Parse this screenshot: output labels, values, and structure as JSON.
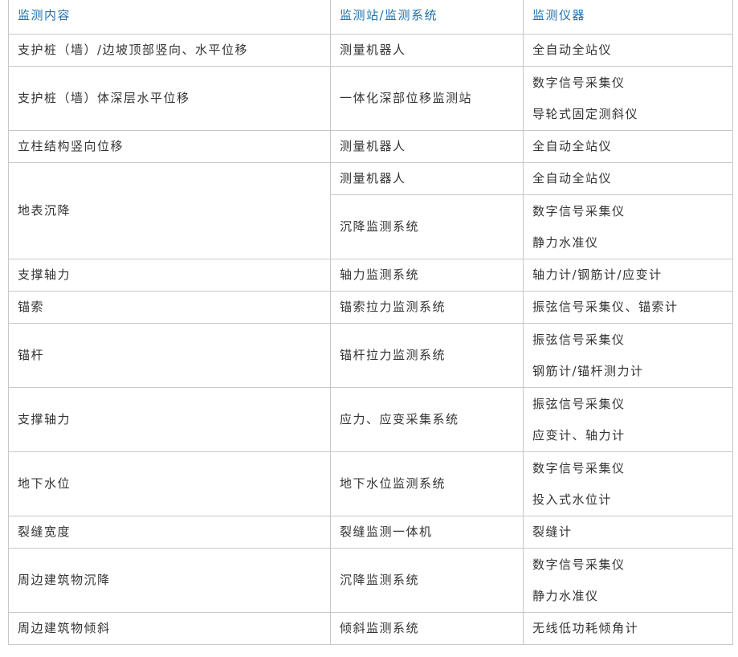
{
  "header": {
    "col1": "监测内容",
    "col2": "监测站/监测系统",
    "col3": "监测仪器"
  },
  "rows": [
    {
      "content": "支护桩（墙）/边坡顶部竖向、水平位移",
      "station": "测量机器人",
      "instruments": [
        "全自动全站仪"
      ]
    },
    {
      "content": "支护桩（墙）体深层水平位移",
      "station": "一体化深部位移监测站",
      "instruments": [
        "数字信号采集仪",
        "导轮式固定测斜仪"
      ]
    },
    {
      "content": "立柱结构竖向位移",
      "station": "测量机器人",
      "instruments": [
        "全自动全站仪"
      ]
    },
    {
      "content": "地表沉降",
      "sub": [
        {
          "station": "测量机器人",
          "instruments": [
            "全自动全站仪"
          ]
        },
        {
          "station": "沉降监测系统",
          "instruments": [
            "数字信号采集仪",
            "静力水准仪"
          ]
        }
      ]
    },
    {
      "content": "支撑轴力",
      "station": "轴力监测系统",
      "instruments": [
        "轴力计/钢筋计/应变计"
      ]
    },
    {
      "content": "锚索",
      "station": "锚索拉力监测系统",
      "instruments": [
        "振弦信号采集仪、锚索计"
      ]
    },
    {
      "content": "锚杆",
      "station": "锚杆拉力监测系统",
      "instruments": [
        "振弦信号采集仪",
        "钢筋计/锚杆测力计"
      ]
    },
    {
      "content": "支撑轴力",
      "station": "应力、应变采集系统",
      "instruments": [
        "振弦信号采集仪",
        "应变计、轴力计"
      ]
    },
    {
      "content": "地下水位",
      "station": "地下水位监测系统",
      "instruments": [
        "数字信号采集仪",
        "投入式水位计"
      ]
    },
    {
      "content": "裂缝宽度",
      "station": "裂缝监测一体机",
      "instruments": [
        "裂缝计"
      ]
    },
    {
      "content": "周边建筑物沉降",
      "station": "沉降监测系统",
      "instruments": [
        "数字信号采集仪",
        "静力水准仪"
      ]
    },
    {
      "content": "周边建筑物倾斜",
      "station": "倾斜监测系统",
      "instruments": [
        "无线低功耗倾角计"
      ]
    }
  ]
}
